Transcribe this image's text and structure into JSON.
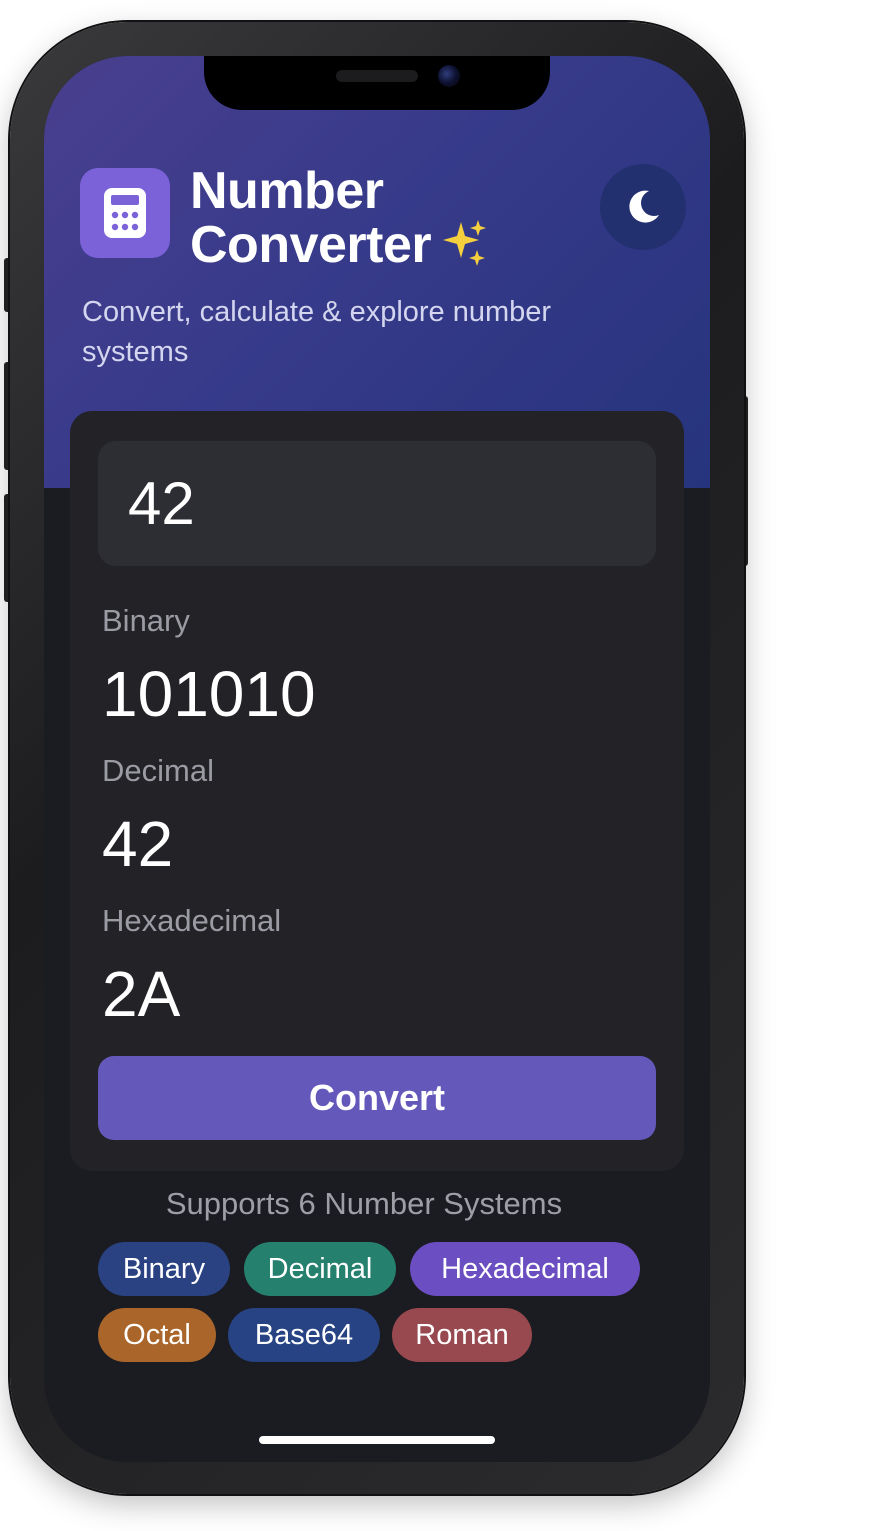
{
  "app": {
    "title_line1": "Number",
    "title_line2": "Converter",
    "title_emoji": "✨",
    "subtitle": "Convert, calculate & explore number systems",
    "theme_toggle_icon": "moon-icon"
  },
  "converter": {
    "input_value": "42",
    "outputs": [
      {
        "label": "Binary",
        "value": "101010"
      },
      {
        "label": "Decimal",
        "value": "42"
      },
      {
        "label": "Hexadecimal",
        "value": "2A"
      }
    ],
    "convert_label": "Convert"
  },
  "systems": {
    "heading": "Supports 6 Number Systems",
    "chips": [
      {
        "label": "Binary",
        "color": "#2a4282"
      },
      {
        "label": "Decimal",
        "color": "#25806e"
      },
      {
        "label": "Hexadecimal",
        "color": "#6b4fc2"
      },
      {
        "label": "Octal",
        "color": "#a9652a"
      },
      {
        "label": "Base64",
        "color": "#274383"
      },
      {
        "label": "Roman",
        "color": "#97494f"
      }
    ]
  },
  "colors": {
    "accent": "#6558bb",
    "header_gradient_start": "#4a3f8f",
    "header_gradient_end": "#26347d",
    "background": "#1b1c21",
    "card": "#222227"
  }
}
